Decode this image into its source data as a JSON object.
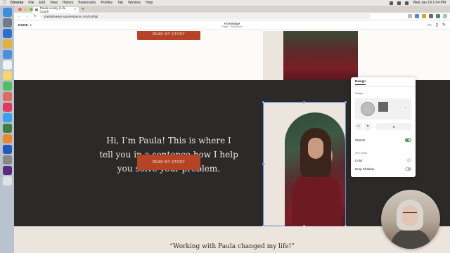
{
  "menubar": {
    "items": [
      "Chrome",
      "File",
      "Edit",
      "View",
      "History",
      "Bookmarks",
      "Profiles",
      "Tab",
      "Window",
      "Help"
    ],
    "clock": "Wed Jan 18  1:04 PM"
  },
  "browser": {
    "tab_title": "Paula Lovely | Life Coach",
    "new_tab_symbol": "+",
    "url": "paulalovely6.squarespace.com/config/"
  },
  "editor": {
    "done_label": "DONE",
    "page_title": "Homepage",
    "page_status": "Page · Published"
  },
  "site": {
    "cta_label": "READ MY STORY",
    "hero_text": "Hi, I’m Paula! This is where I tell you in a sentence how I help you solve your problem.",
    "testimonial": "“Working with Paula changed my life!”"
  },
  "design_panel": {
    "tab_label": "Design",
    "shape_label": "Shape",
    "radius_value": "0",
    "stretch_label": "Stretch",
    "stretch_enabled": true,
    "styling_label": "STYLING",
    "color_label": "Color",
    "drop_shadow_label": "Drop Shadow",
    "drop_shadow_enabled": false
  },
  "colors": {
    "accent_button": "#b54427",
    "dark_section": "#2b2a28",
    "tan_section": "#ece5dd",
    "selection_outline": "#5b8ad6",
    "toggle_on": "#4d9c5a"
  },
  "icons": {
    "dock": [
      "finder-icon",
      "launchpad-icon",
      "safari-icon",
      "chrome-icon",
      "mail-icon",
      "calendar-icon",
      "notes-icon",
      "messages-icon",
      "photos-icon",
      "music-icon",
      "app-store-icon",
      "settings-icon",
      "trash-icon"
    ]
  }
}
